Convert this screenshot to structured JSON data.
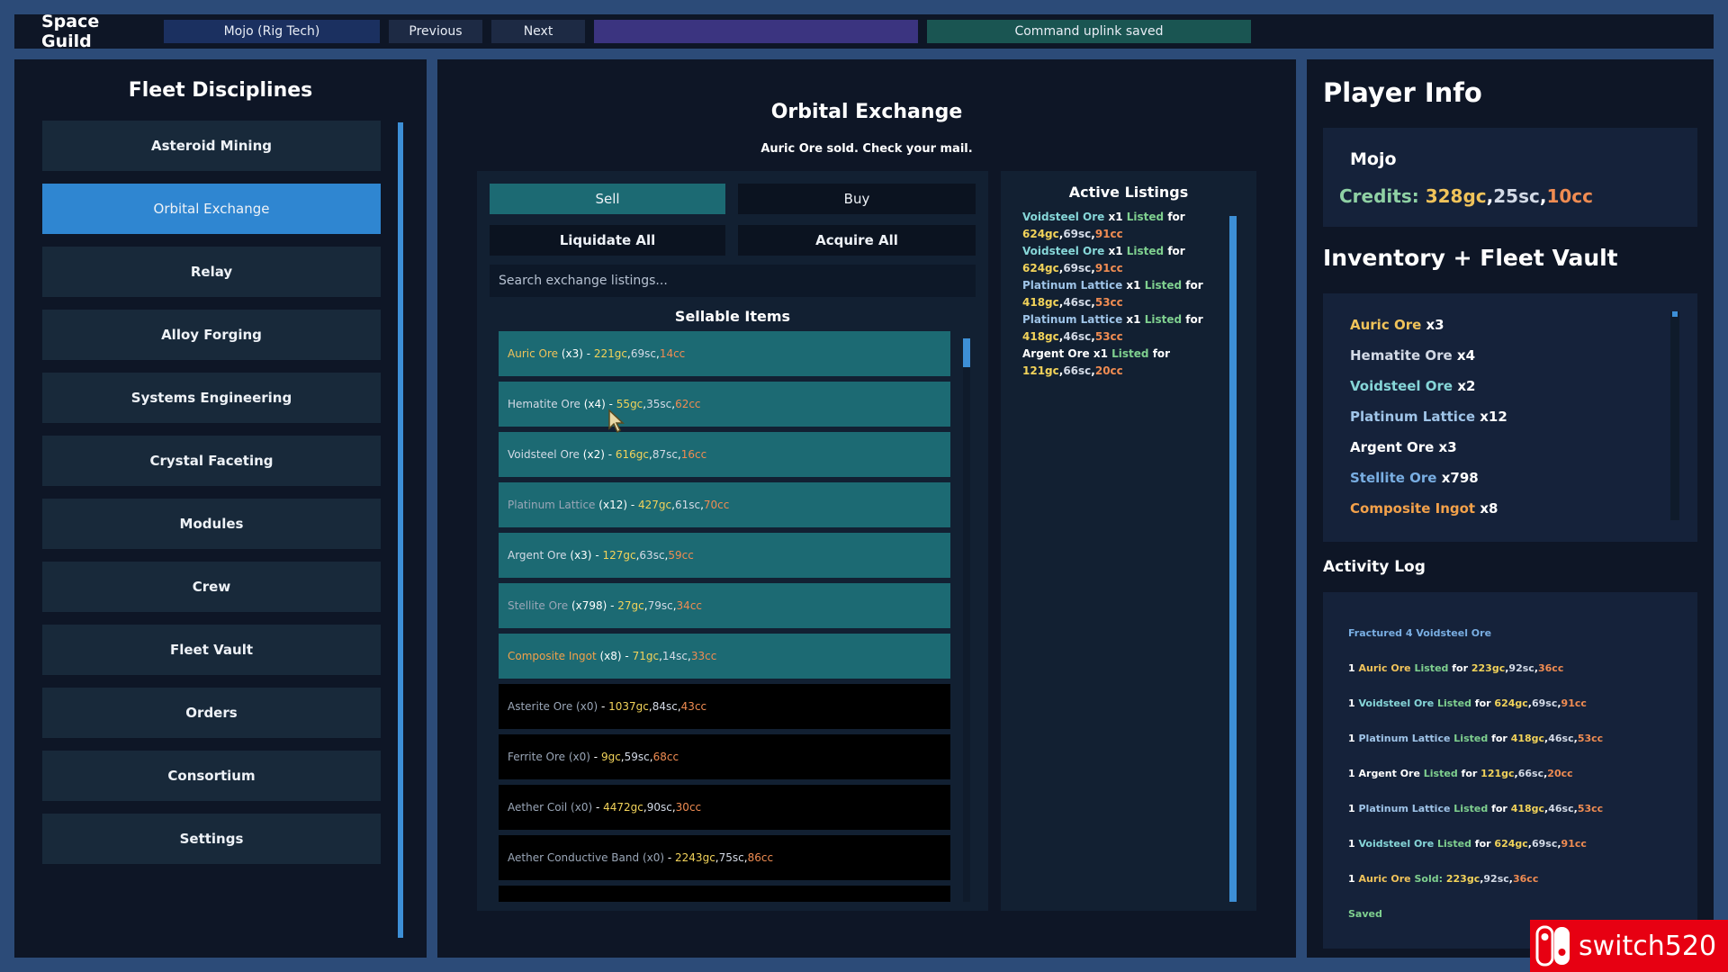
{
  "topbar": {
    "brand": "Space Guild",
    "profile": "Mojo (Rig Tech)",
    "previous": "Previous",
    "next": "Next",
    "status": "Command uplink saved"
  },
  "left": {
    "title": "Fleet Disciplines",
    "nav": [
      {
        "label": "Asteroid Mining",
        "active": false
      },
      {
        "label": "Orbital Exchange",
        "active": true
      },
      {
        "label": "Relay",
        "active": false
      },
      {
        "label": "Alloy Forging",
        "active": false
      },
      {
        "label": "Systems Engineering",
        "active": false
      },
      {
        "label": "Crystal Faceting",
        "active": false
      },
      {
        "label": "Modules",
        "active": false
      },
      {
        "label": "Crew",
        "active": false
      },
      {
        "label": "Fleet Vault",
        "active": false
      },
      {
        "label": "Orders",
        "active": false
      },
      {
        "label": "Consortium",
        "active": false
      },
      {
        "label": "Settings",
        "active": false
      }
    ]
  },
  "center": {
    "title": "Orbital Exchange",
    "message": "Auric Ore sold. Check your mail.",
    "sell": "Sell",
    "buy": "Buy",
    "liquidate_all": "Liquidate All",
    "acquire_all": "Acquire All",
    "search_placeholder": "Search exchange listings...",
    "sellable_title": "Sellable Items",
    "items": [
      {
        "name": "Auric Ore",
        "qty": "(x3)",
        "gc": "221gc",
        "sc": "69sc",
        "cc": "14cc",
        "name_color": "c-gold",
        "owned": true
      },
      {
        "name": "Hematite Ore",
        "qty": "(x4)",
        "gc": "55gc",
        "sc": "35sc",
        "cc": "62cc",
        "name_color": "c-silver",
        "owned": true
      },
      {
        "name": "Voidsteel Ore",
        "qty": "(x2)",
        "gc": "616gc",
        "sc": "87sc",
        "cc": "16cc",
        "name_color": "c-silver",
        "owned": true
      },
      {
        "name": "Platinum Lattice",
        "qty": "(x12)",
        "gc": "427gc",
        "sc": "61sc",
        "cc": "70cc",
        "name_color": "c-dim",
        "owned": true
      },
      {
        "name": "Argent Ore",
        "qty": "(x3)",
        "gc": "127gc",
        "sc": "63sc",
        "cc": "59cc",
        "name_color": "c-silver",
        "owned": true
      },
      {
        "name": "Stellite Ore",
        "qty": "(x798)",
        "gc": "27gc",
        "sc": "79sc",
        "cc": "34cc",
        "name_color": "c-dim",
        "owned": true
      },
      {
        "name": "Composite Ingot",
        "qty": "(x8)",
        "gc": "71gc",
        "sc": "14sc",
        "cc": "33cc",
        "name_color": "c-orange",
        "owned": true
      },
      {
        "name": "Asterite Ore",
        "qty": "(x0)",
        "gc": "1037gc",
        "sc": "84sc",
        "cc": "43cc",
        "name_color": "c-dim",
        "owned": false
      },
      {
        "name": "Ferrite Ore",
        "qty": "(x0)",
        "gc": "9gc",
        "sc": "59sc",
        "cc": "68cc",
        "name_color": "c-dim",
        "owned": false
      },
      {
        "name": "Aether Coil",
        "qty": "(x0)",
        "gc": "4472gc",
        "sc": "90sc",
        "cc": "30cc",
        "name_color": "c-dim",
        "owned": false
      },
      {
        "name": "Aether Conductive Band",
        "qty": "(x0)",
        "gc": "2243gc",
        "sc": "75sc",
        "cc": "86cc",
        "name_color": "c-dim",
        "owned": false
      },
      {
        "name": "",
        "qty": "",
        "gc": "",
        "sc": "",
        "cc": "",
        "name_color": "c-dim",
        "owned": false
      }
    ],
    "active_listings_title": "Active Listings",
    "listings": [
      {
        "name": "Voidsteel Ore",
        "qty": "x1",
        "gc": "624gc",
        "sc": "69sc",
        "cc": "91cc",
        "name_color": "c-void"
      },
      {
        "name": "Voidsteel Ore",
        "qty": "x1",
        "gc": "624gc",
        "sc": "69sc",
        "cc": "91cc",
        "name_color": "c-void"
      },
      {
        "name": "Platinum Lattice",
        "qty": "x1",
        "gc": "418gc",
        "sc": "46sc",
        "cc": "53cc",
        "name_color": "c-plat"
      },
      {
        "name": "Platinum Lattice",
        "qty": "x1",
        "gc": "418gc",
        "sc": "46sc",
        "cc": "53cc",
        "name_color": "c-plat"
      },
      {
        "name": "Argent Ore",
        "qty": "x1",
        "gc": "121gc",
        "sc": "66sc",
        "cc": "20cc",
        "name_color": "c-white"
      }
    ],
    "listed_word": "Listed",
    "for_word": "for"
  },
  "right": {
    "title": "Player Info",
    "player_name": "Mojo",
    "credits_label": "Credits:",
    "credits_gc": "328gc",
    "credits_sc": "25sc",
    "credits_cc": "10cc",
    "inventory_title": "Inventory + Fleet Vault",
    "inventory": [
      {
        "name": "Auric Ore",
        "qty": "x3",
        "color": "c-gold"
      },
      {
        "name": "Hematite Ore",
        "qty": "x4",
        "color": "c-silver"
      },
      {
        "name": "Voidsteel Ore",
        "qty": "x2",
        "color": "c-void"
      },
      {
        "name": "Platinum Lattice",
        "qty": "x12",
        "color": "c-plat"
      },
      {
        "name": "Argent Ore",
        "qty": "x3",
        "color": "c-white"
      },
      {
        "name": "Stellite Ore",
        "qty": "x798",
        "color": "c-blue"
      },
      {
        "name": "Composite Ingot",
        "qty": "x8",
        "color": "c-orange"
      }
    ],
    "activity_title": "Activity Log",
    "log": [
      {
        "type": "fractured",
        "pre": "Fractured 4",
        "name": "Voidsteel Ore",
        "color": "c-blue"
      },
      {
        "type": "listed",
        "qty": "1",
        "name": "Auric Ore",
        "color": "c-gold",
        "word": "Listed",
        "for": "for",
        "gc": "223gc",
        "sc": "92sc",
        "cc": "36cc"
      },
      {
        "type": "listed",
        "qty": "1",
        "name": "Voidsteel Ore",
        "color": "c-void",
        "word": "Listed",
        "for": "for",
        "gc": "624gc",
        "sc": "69sc",
        "cc": "91cc"
      },
      {
        "type": "listed",
        "qty": "1",
        "name": "Platinum Lattice",
        "color": "c-plat",
        "word": "Listed",
        "for": "for",
        "gc": "418gc",
        "sc": "46sc",
        "cc": "53cc"
      },
      {
        "type": "listed",
        "qty": "1",
        "name": "Argent Ore",
        "color": "c-white",
        "word": "Listed",
        "for": "for",
        "gc": "121gc",
        "sc": "66sc",
        "cc": "20cc"
      },
      {
        "type": "listed",
        "qty": "1",
        "name": "Platinum Lattice",
        "color": "c-plat",
        "word": "Listed",
        "for": "for",
        "gc": "418gc",
        "sc": "46sc",
        "cc": "53cc"
      },
      {
        "type": "listed",
        "qty": "1",
        "name": "Voidsteel Ore",
        "color": "c-void",
        "word": "Listed",
        "for": "for",
        "gc": "624gc",
        "sc": "69sc",
        "cc": "91cc"
      },
      {
        "type": "sold",
        "qty": "1",
        "name": "Auric Ore",
        "color": "c-gold",
        "word": "Sold:",
        "gc": "223gc",
        "sc": "92sc",
        "cc": "36cc"
      },
      {
        "type": "saved",
        "text": "Saved"
      }
    ]
  },
  "watermark": {
    "text": "switch520"
  },
  "colors": {
    "accent_blue": "#2f86d1",
    "teal_row": "#1c6a73",
    "gold": "#f0c35a",
    "copper": "#f08c52",
    "listed_green": "#7fd08f",
    "watermark_red": "#e70012"
  }
}
